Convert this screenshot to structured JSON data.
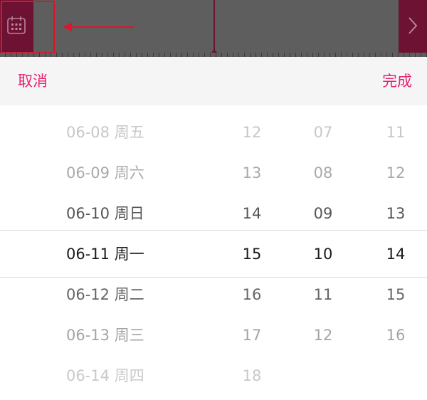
{
  "topbar": {
    "calendar_icon": "calendar-icon",
    "next_icon": "chevron-right-icon",
    "accent_color": "#6e1234",
    "annotation_color": "#e3112a"
  },
  "toolbar": {
    "cancel_label": "取消",
    "done_label": "完成",
    "accent_color": "#e72470"
  },
  "picker": {
    "selected_index": 3,
    "dates": [
      "06-08 周五",
      "06-09 周六",
      "06-10 周日",
      "06-11 周一",
      "06-12 周二",
      "06-13 周三",
      "06-14 周四"
    ],
    "hours": [
      "12",
      "13",
      "14",
      "15",
      "16",
      "17",
      "18"
    ],
    "minutes": [
      "07",
      "08",
      "09",
      "10",
      "11",
      "12"
    ],
    "seconds": [
      "11",
      "12",
      "13",
      "14",
      "15",
      "16"
    ]
  }
}
